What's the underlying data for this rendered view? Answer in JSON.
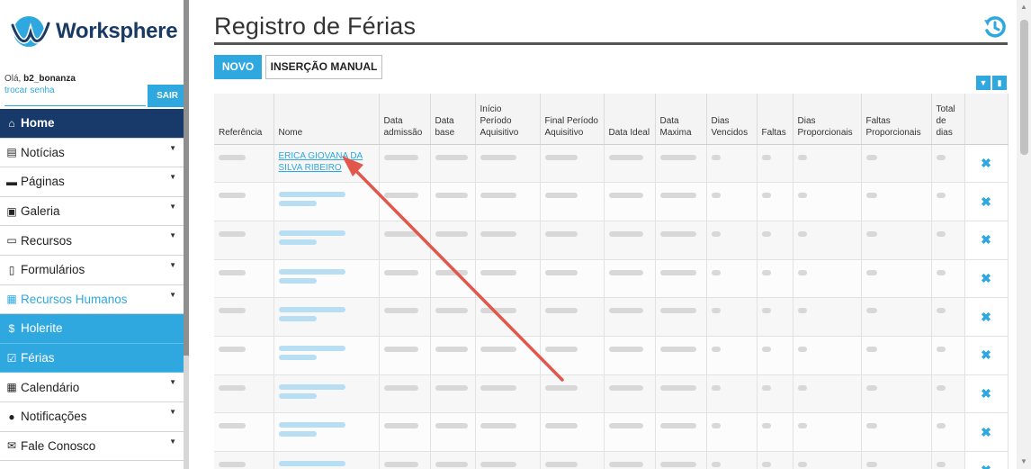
{
  "brand": {
    "name": "Worksphere"
  },
  "user": {
    "greeting": "Olá, ",
    "username": "b2_bonanza",
    "change_password": "trocar senha",
    "logout": "SAIR"
  },
  "menu": [
    {
      "label": "Home",
      "icon": "home-icon"
    },
    {
      "label": "Notícias",
      "icon": "newspaper-icon"
    },
    {
      "label": "Páginas",
      "icon": "window-icon"
    },
    {
      "label": "Galeria",
      "icon": "image-icon"
    },
    {
      "label": "Recursos",
      "icon": "laptop-icon"
    },
    {
      "label": "Formulários",
      "icon": "file-icon"
    },
    {
      "label": "Recursos Humanos",
      "icon": "id-card-icon"
    },
    {
      "label": "Holerite",
      "icon": "dollar-icon"
    },
    {
      "label": "Férias",
      "icon": "calendar-check-icon"
    },
    {
      "label": "Calendário",
      "icon": "calendar-icon"
    },
    {
      "label": "Notificações",
      "icon": "info-icon"
    },
    {
      "label": "Fale Conosco",
      "icon": "envelope-icon"
    }
  ],
  "page": {
    "title": "Registro de Férias",
    "new_button": "NOVO",
    "manual_button": "INSERÇÃO MANUAL"
  },
  "table": {
    "headers": [
      "Referência",
      "Nome",
      "Data admissão",
      "Data base",
      "Início Período Aquisitivo",
      "Final Período Aquisitivo",
      "Data Ideal",
      "Data Maxima",
      "Dias Vencidos",
      "Faltas",
      "Dias Proporcionais",
      "Faltas Proporcionais",
      "Total de dias"
    ],
    "first_row_name": "ERICA GIOVANA DA SILVA RIBEIRO",
    "delete_glyph": "✖"
  },
  "colors": {
    "accent": "#2fa8e0",
    "home_bg": "#173a6b",
    "arrow": "#e2574c"
  }
}
